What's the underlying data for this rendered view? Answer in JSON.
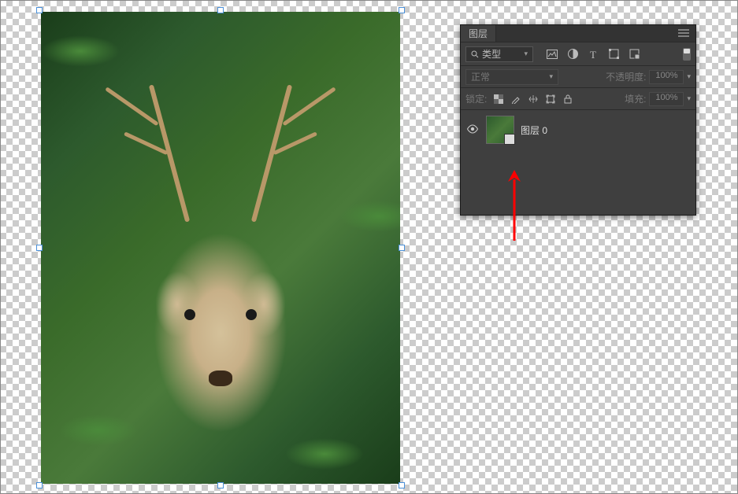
{
  "canvas": {
    "image_description": "deer-in-ferns"
  },
  "layers_panel": {
    "tab_title": "图层",
    "filter": {
      "search_label": "类型",
      "icons": [
        "image-filter",
        "adjustment-filter",
        "text-filter",
        "shape-filter",
        "smartobject-filter"
      ]
    },
    "blend": {
      "mode": "正常",
      "opacity_label": "不透明度:",
      "opacity_value": "100%"
    },
    "lock": {
      "label": "锁定:",
      "fill_label": "填充:",
      "fill_value": "100%"
    },
    "layers": [
      {
        "name": "图层 0",
        "visible": true,
        "is_smart_object": true
      }
    ]
  }
}
